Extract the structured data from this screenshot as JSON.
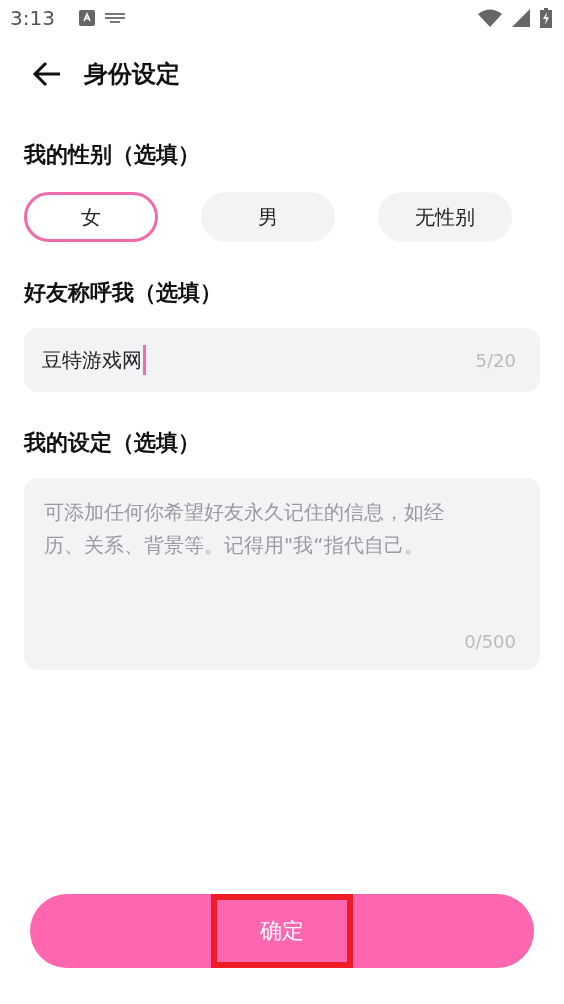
{
  "status_bar": {
    "time": "3:13"
  },
  "header": {
    "title": "身份设定"
  },
  "gender": {
    "label": "我的性别（选填）",
    "options": [
      {
        "label": "女",
        "selected": true
      },
      {
        "label": "男",
        "selected": false
      },
      {
        "label": "无性别",
        "selected": false
      }
    ]
  },
  "nickname": {
    "label": "好友称呼我（选填）",
    "value": "豆特游戏网",
    "counter": "5/20"
  },
  "persona": {
    "label": "我的设定（选填）",
    "placeholder": "可添加任何你希望好友永久记住的信息，如经历、关系、背景等。记得用\"我“指代自己。",
    "counter": "0/500"
  },
  "confirm_button": {
    "label": "确定",
    "highlighted": true
  }
}
